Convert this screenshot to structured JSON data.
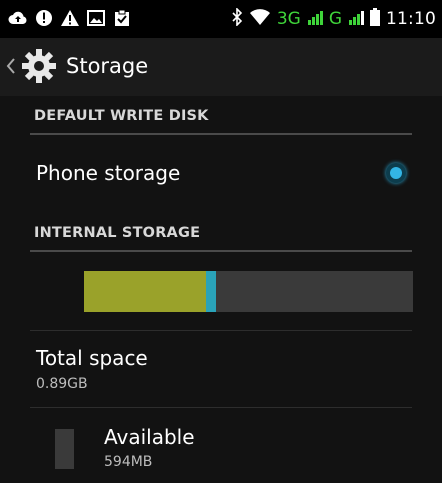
{
  "status_bar": {
    "left_icons": [
      "cloud-upload-icon",
      "alert-icon",
      "warning-icon",
      "image-icon",
      "clipboard-check-icon"
    ],
    "bluetooth_icon": "bluetooth-icon",
    "wifi_icon": "wifi-icon",
    "network_type_1": "3G",
    "network_type_2": "G",
    "battery_icon": "battery-icon",
    "time": "11:10"
  },
  "action_bar": {
    "back_icon": "chevron-left-icon",
    "app_icon": "gear-icon",
    "title": "Storage"
  },
  "sections": {
    "default_write_disk": {
      "header": "DEFAULT WRITE DISK",
      "option_label": "Phone storage",
      "selected": true
    },
    "internal_storage": {
      "header": "INTERNAL STORAGE",
      "usage": [
        {
          "name": "used",
          "fraction": 0.37,
          "color": "#9aa22a"
        },
        {
          "name": "apps",
          "fraction": 0.03,
          "color": "#2aa3b9"
        },
        {
          "name": "free",
          "fraction": 0.6,
          "color": "#3a3a3a"
        }
      ],
      "total_space": {
        "label": "Total space",
        "value": "0.89GB"
      },
      "available": {
        "label": "Available",
        "value": "594MB",
        "color": "#3a3a3a"
      }
    }
  },
  "colors": {
    "accent": "#33b5e5",
    "background": "#121212",
    "action_bar": "#1b1b1b"
  }
}
